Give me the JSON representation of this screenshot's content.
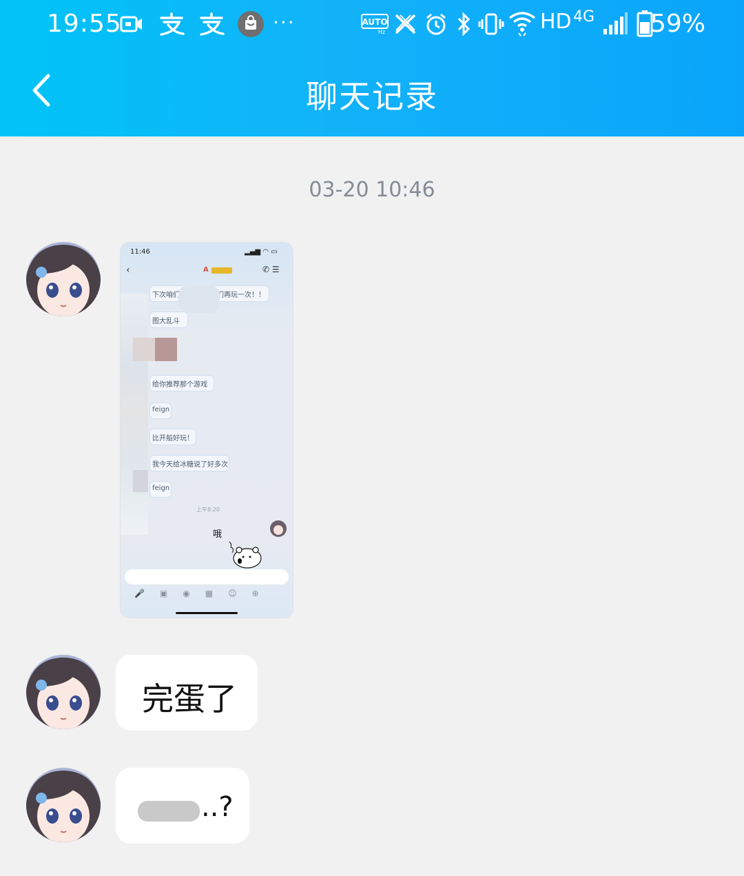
{
  "status_bar": {
    "time": "19:55",
    "battery_pct": "59%",
    "network_hd": "HD",
    "network_gen": "4G",
    "auto_label": "AUTO",
    "icons": [
      "video-icon",
      "alipay-icon",
      "alipay-icon",
      "shopping-bag-icon",
      "more-dots-icon",
      "auto-hz-icon",
      "x-icon",
      "alarm-icon",
      "bluetooth-icon",
      "vibrate-icon",
      "wifi-icon",
      "signal-icon",
      "battery-icon"
    ]
  },
  "header": {
    "title": "聊天记录"
  },
  "messages": {
    "timestamp": "03-20 10:46",
    "text1": "完蛋了",
    "text2": "..?"
  },
  "screenshot": {
    "time": "11:46",
    "contact": "A",
    "lines": [
      "下次咱们",
      "们再玩一次！！",
      "图大乱斗",
      "给你推荐那个游戏",
      "feign",
      "比开船好玩！",
      "我今天给冰糖说了好多次",
      "feign"
    ],
    "inner_time": "上午8:20",
    "sticker_text": "哦"
  },
  "colors": {
    "header_start": "#00c4f7",
    "header_end": "#0aa5fb",
    "background": "#f1f1f1",
    "bubble": "#ffffff"
  }
}
